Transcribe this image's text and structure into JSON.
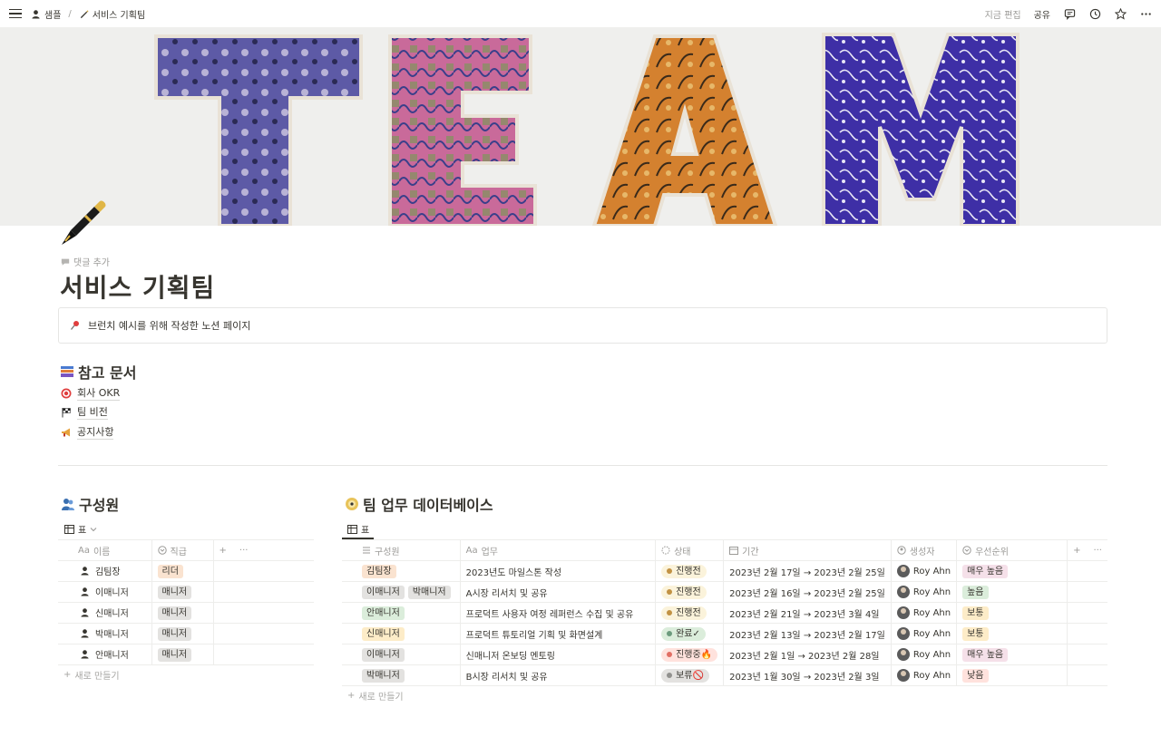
{
  "topbar": {
    "breadcrumb": [
      {
        "label": "샘플",
        "icon": "person-icon"
      },
      {
        "label": "서비스 기획팀",
        "icon": "pen-icon"
      }
    ],
    "edit_status": "지금 편집",
    "share_label": "공유"
  },
  "cover": {
    "letters": [
      "T",
      "E",
      "A",
      "M"
    ]
  },
  "page": {
    "add_comment": "댓글 추가",
    "title": "서비스 기획팀",
    "callout_text": "브런치 예시를 위해 작성한 노션 페이지"
  },
  "references": {
    "title": "참고 문서",
    "links": [
      "회사 OKR",
      "팀 비전",
      "공지사항"
    ]
  },
  "members_db": {
    "title": "구성원",
    "view_label": "표",
    "columns": [
      "이름",
      "직급"
    ],
    "rows": [
      {
        "name": "김팀장",
        "position": "리더",
        "position_color": "#fae3d0"
      },
      {
        "name": "이매니저",
        "position": "매니저",
        "position_color": "#e3e2e0"
      },
      {
        "name": "신매니저",
        "position": "매니저",
        "position_color": "#e3e2e0"
      },
      {
        "name": "박매니저",
        "position": "매니저",
        "position_color": "#e3e2e0"
      },
      {
        "name": "안매니저",
        "position": "매니저",
        "position_color": "#e3e2e0"
      }
    ],
    "new_label": "새로 만들기"
  },
  "tasks_db": {
    "title": "팀 업무 데이터베이스",
    "view_label": "표",
    "columns": [
      "구성원",
      "업무",
      "상태",
      "기간",
      "생성자",
      "우선순위"
    ],
    "rows": [
      {
        "members": [
          {
            "name": "김팀장",
            "color": "#fae3d0"
          }
        ],
        "task": "2023년도 마일스톤 작성",
        "status": "진행전",
        "status_bg": "#fbf3db",
        "status_dot": "#c29243",
        "period": "2023년 2월 17일 → 2023년 2월 25일",
        "creator": "Roy Ahn",
        "priority": "매우 높음",
        "priority_bg": "#f5e0e9"
      },
      {
        "members": [
          {
            "name": "이매니저",
            "color": "#e3e2e0"
          },
          {
            "name": "박매니저",
            "color": "#e3e2e0"
          }
        ],
        "task": "A시장 리서치 및 공유",
        "status": "진행전",
        "status_bg": "#fbf3db",
        "status_dot": "#c29243",
        "period": "2023년 2월 16일 → 2023년 2월 25일",
        "creator": "Roy Ahn",
        "priority": "높음",
        "priority_bg": "#dbeddb"
      },
      {
        "members": [
          {
            "name": "안매니저",
            "color": "#dbeddb"
          }
        ],
        "task": "프로덕트 사용자 여정 레퍼런스 수집 및 공유",
        "status": "진행전",
        "status_bg": "#fbf3db",
        "status_dot": "#c29243",
        "period": "2023년 2월 21일 → 2023년 3월 4일",
        "creator": "Roy Ahn",
        "priority": "보통",
        "priority_bg": "#fdecc8"
      },
      {
        "members": [
          {
            "name": "신매니저",
            "color": "#fdecc8"
          }
        ],
        "task": "프로덕트 튜토리얼 기획 및 화면설계",
        "status": "완료✓",
        "status_bg": "#dbeddb",
        "status_dot": "#6c9b7d",
        "period": "2023년 2월 13일 → 2023년 2월 17일",
        "creator": "Roy Ahn",
        "priority": "보통",
        "priority_bg": "#fdecc8"
      },
      {
        "members": [
          {
            "name": "이매니저",
            "color": "#e3e2e0"
          }
        ],
        "task": "신매니저 온보딩 멘토링",
        "status": "진행중🔥",
        "status_bg": "#ffe2dd",
        "status_dot": "#e16f64",
        "period": "2023년 2월 1일 → 2023년 2월 28일",
        "creator": "Roy Ahn",
        "priority": "매우 높음",
        "priority_bg": "#f5e0e9"
      },
      {
        "members": [
          {
            "name": "박매니저",
            "color": "#e3e2e0"
          }
        ],
        "task": "B시장 리서치 및 공유",
        "status": "보류🚫",
        "status_bg": "#e3e2e0",
        "status_dot": "#91918e",
        "period": "2023년 1월 30일 → 2023년 2월 3일",
        "creator": "Roy Ahn",
        "priority": "낮음",
        "priority_bg": "#ffe2dd"
      }
    ],
    "new_label": "새로 만들기"
  }
}
